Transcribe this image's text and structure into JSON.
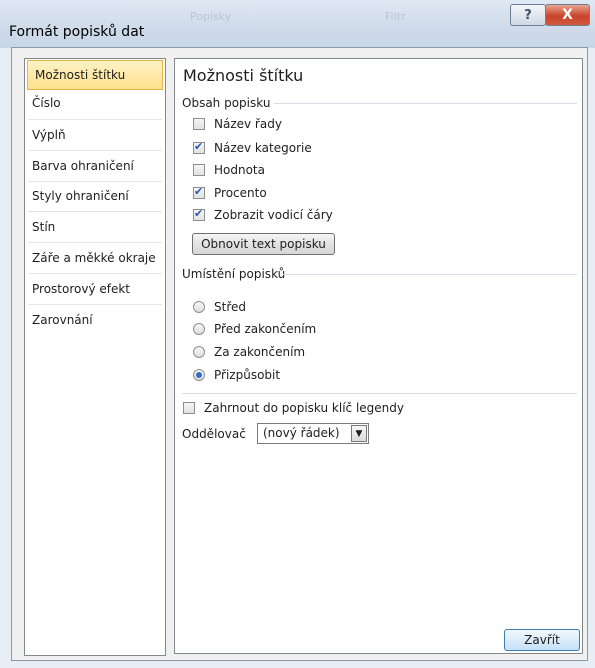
{
  "window": {
    "title": "Formát popisků dat",
    "help_glyph": "?",
    "close_glyph": "X",
    "ghost_labels": [
      "Popisky",
      "Filtr"
    ]
  },
  "sidebar": {
    "items": [
      {
        "label": "Možnosti štítku",
        "selected": true
      },
      {
        "label": "Číslo",
        "selected": false
      },
      {
        "label": "Výplň",
        "selected": false
      },
      {
        "label": "Barva ohraničení",
        "selected": false
      },
      {
        "label": "Styly ohraničení",
        "selected": false
      },
      {
        "label": "Stín",
        "selected": false
      },
      {
        "label": "Záře a měkké okraje",
        "selected": false
      },
      {
        "label": "Prostorový efekt",
        "selected": false
      },
      {
        "label": "Zarovnání",
        "selected": false
      }
    ]
  },
  "panel": {
    "heading": "Možnosti štítku",
    "contents_group": {
      "title": "Obsah popisku",
      "checkboxes": [
        {
          "label": "Název řady",
          "checked": false
        },
        {
          "label": "Název kategorie",
          "checked": true
        },
        {
          "label": "Hodnota",
          "checked": false
        },
        {
          "label": "Procento",
          "checked": true
        },
        {
          "label": "Zobrazit vodicí čáry",
          "checked": true
        }
      ],
      "reset_button": "Obnovit text popisku"
    },
    "position_group": {
      "title": "Umístění popisků",
      "radios": [
        {
          "label": "Střed",
          "selected": false
        },
        {
          "label": "Před zakončením",
          "selected": false
        },
        {
          "label": "Za zakončením",
          "selected": false
        },
        {
          "label": "Přizpůsobit",
          "selected": true
        }
      ]
    },
    "legend_key": {
      "label": "Zahrnout do popisku klíč legendy",
      "checked": false
    },
    "separator": {
      "label": "Oddělovač",
      "value": "(nový řádek)"
    }
  },
  "footer": {
    "close_button": "Zavřít"
  }
}
